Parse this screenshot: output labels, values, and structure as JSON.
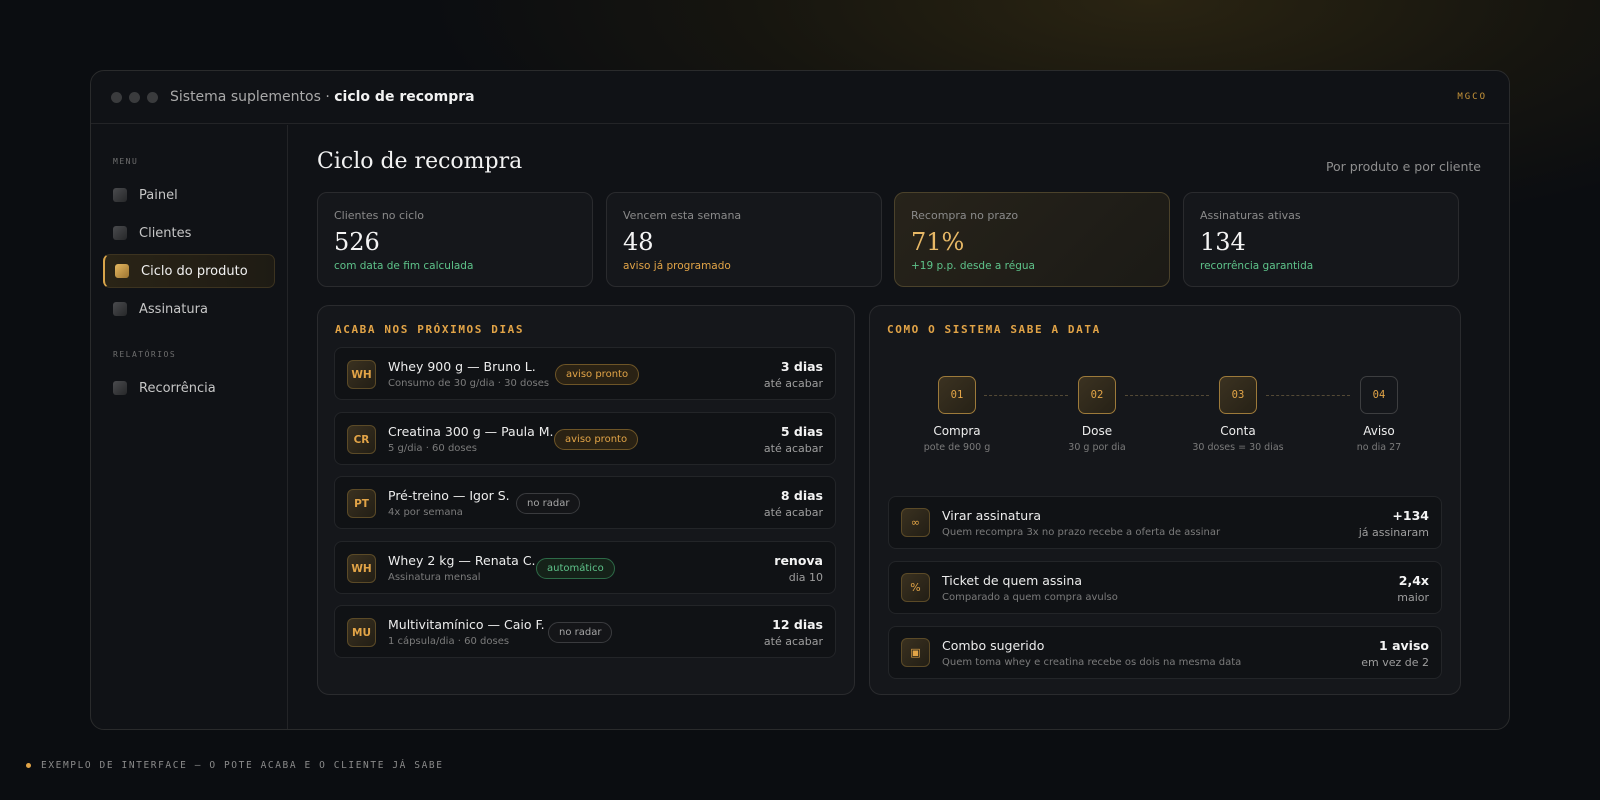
{
  "window": {
    "title_prefix": "Sistema suplementos · ",
    "title_bold": "ciclo de recompra",
    "brand": "MGCO"
  },
  "sidebar": {
    "section_menu": "MENU",
    "section_reports": "RELATÓRIOS",
    "items": [
      {
        "label": "Painel"
      },
      {
        "label": "Clientes"
      },
      {
        "label": "Ciclo do produto"
      },
      {
        "label": "Assinatura"
      },
      {
        "label": "Recorrência"
      }
    ],
    "active_item": "Ciclo do produto"
  },
  "page": {
    "title": "Ciclo de recompra",
    "subtitle": "Por produto e por cliente"
  },
  "kpis": [
    {
      "label": "Clientes no ciclo",
      "value": "526",
      "note": "com data de fim calculada"
    },
    {
      "label": "Vencem esta semana",
      "value": "48",
      "note": "aviso já programado"
    },
    {
      "label": "Recompra no prazo",
      "value": "71%",
      "note": "+19 p.p. desde a régua"
    },
    {
      "label": "Assinaturas ativas",
      "value": "134",
      "note": "recorrência garantida"
    }
  ],
  "upcoming": {
    "heading": "ACABA NOS PRÓXIMOS DIAS",
    "rows": [
      {
        "icon": "WH",
        "title": "Whey 900 g — Bruno L.",
        "sub": "Consumo de 30 g/dia · 30 doses",
        "badge": "aviso pronto",
        "value": "3 dias",
        "value_sub": "até acabar"
      },
      {
        "icon": "CR",
        "title": "Creatina 300 g — Paula M.",
        "sub": "5 g/dia · 60 doses",
        "badge": "aviso pronto",
        "value": "5 dias",
        "value_sub": "até acabar"
      },
      {
        "icon": "PT",
        "title": "Pré-treino — Igor S.",
        "sub": "4x por semana",
        "badge": "no radar",
        "value": "8 dias",
        "value_sub": "até acabar"
      },
      {
        "icon": "WH",
        "title": "Whey 2 kg — Renata C.",
        "sub": "Assinatura mensal",
        "badge": "automático",
        "value": "renova",
        "value_sub": "dia 10"
      },
      {
        "icon": "MU",
        "title": "Multivitamínico — Caio F.",
        "sub": "1 cápsula/dia · 60 doses",
        "badge": "no radar",
        "value": "12 dias",
        "value_sub": "até acabar"
      }
    ]
  },
  "how": {
    "heading": "COMO O SISTEMA SABE A DATA",
    "steps": [
      {
        "num": "01",
        "label": "Compra",
        "sub": "pote de 900 g"
      },
      {
        "num": "02",
        "label": "Dose",
        "sub": "30 g por dia"
      },
      {
        "num": "03",
        "label": "Conta",
        "sub": "30 doses = 30 dias"
      },
      {
        "num": "04",
        "label": "Aviso",
        "sub": "no dia 27"
      }
    ],
    "features": [
      {
        "icon": "∞",
        "title": "Virar assinatura",
        "sub": "Quem recompra 3x no prazo recebe a oferta de assinar",
        "value": "+134",
        "value_sub": "já assinaram"
      },
      {
        "icon": "%",
        "title": "Ticket de quem assina",
        "sub": "Comparado a quem compra avulso",
        "value": "2,4x",
        "value_sub": "maior"
      },
      {
        "icon": "▣",
        "title": "Combo sugerido",
        "sub": "Quem toma whey e creatina recebe os dois na mesma data",
        "value": "1 aviso",
        "value_sub": "em vez de 2"
      }
    ]
  },
  "footer": {
    "caption": "EXEMPLO DE INTERFACE — O POTE ACABA E O CLIENTE JÁ SABE"
  },
  "colors": {
    "accent": "#e2a447",
    "positive": "#5ec38a",
    "background": "#0b0d11",
    "panel": "#15171b"
  }
}
